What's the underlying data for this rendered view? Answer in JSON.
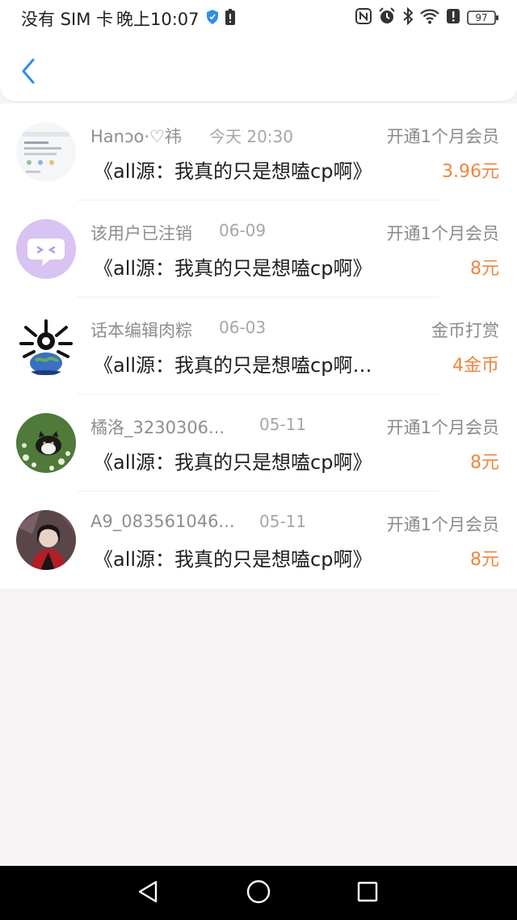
{
  "status_bar": {
    "carrier": "没有 SIM 卡",
    "time": "晚上10:07",
    "battery": "97",
    "icons": [
      "shield-icon",
      "alert-icon",
      "nfc-icon",
      "alarm-icon",
      "bluetooth-icon",
      "wifi-icon",
      "battery-icon"
    ]
  },
  "header": {
    "back_icon": "chevron-left-icon"
  },
  "records": [
    {
      "name": "Hanↄo·♡祎",
      "date": "今天 20:30",
      "type": "开通1个月会员",
      "title": "《all源：我真的只是想嗑cp啊》",
      "amount": "3.96元",
      "avatar": "screenshot-thumbnail"
    },
    {
      "name": "该用户已注销",
      "date": "06-09",
      "type": "开通1个月会员",
      "title": "《all源：我真的只是想嗑cp啊》",
      "amount": "8元",
      "avatar": "chat-bubble-avatar"
    },
    {
      "name": "话本编辑肉粽",
      "date": "06-03",
      "type": "金币打赏",
      "title": "《all源：我真的只是想嗑cp啊…",
      "amount": "4金币",
      "avatar": "globe-avatar"
    },
    {
      "name": "橘洛_3230306...",
      "date": "05-11",
      "type": "开通1个月会员",
      "title": "《all源：我真的只是想嗑cp啊》",
      "amount": "8元",
      "avatar": "cat-avatar"
    },
    {
      "name": "A9_083561046...",
      "date": "05-11",
      "type": "开通1个月会员",
      "title": "《all源：我真的只是想嗑cp啊》",
      "amount": "8元",
      "avatar": "portrait-avatar"
    }
  ],
  "nav": [
    "back-triangle-icon",
    "home-circle-icon",
    "recents-square-icon"
  ],
  "colors": {
    "accent": "#2f8ee6",
    "amount": "#ef8540",
    "background": "#f6f4f5"
  }
}
